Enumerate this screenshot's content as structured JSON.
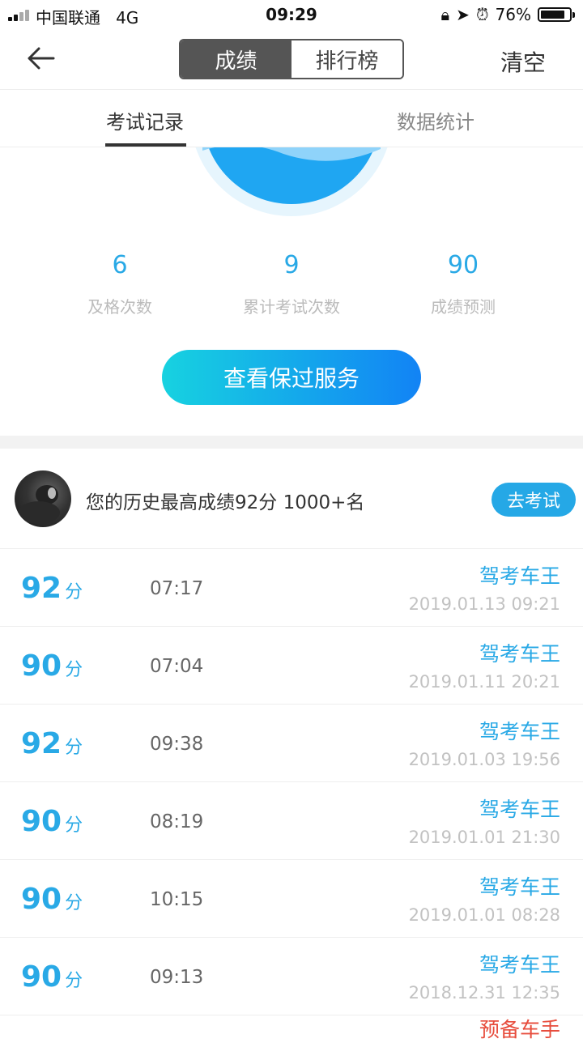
{
  "status": {
    "carrier": "中国联通",
    "network": "4G",
    "time": "09:29",
    "battery": "76%"
  },
  "nav": {
    "seg_scores": "成绩",
    "seg_ranking": "排行榜",
    "clear": "清空"
  },
  "tabs": {
    "records": "考试记录",
    "stats": "数据统计"
  },
  "stats": [
    {
      "value": "6",
      "label": "及格次数"
    },
    {
      "value": "9",
      "label": "累计考试次数"
    },
    {
      "value": "90",
      "label": "成绩预测"
    }
  ],
  "cta": "查看保过服务",
  "best": {
    "text": "您的历史最高成绩92分  1000+名",
    "button": "去考试"
  },
  "records": [
    {
      "score": "92",
      "unit": "分",
      "duration": "07:17",
      "source": "驾考车王",
      "date": "2019.01.13 09:21"
    },
    {
      "score": "90",
      "unit": "分",
      "duration": "07:04",
      "source": "驾考车王",
      "date": "2019.01.11 20:21"
    },
    {
      "score": "92",
      "unit": "分",
      "duration": "09:38",
      "source": "驾考车王",
      "date": "2019.01.03 19:56"
    },
    {
      "score": "90",
      "unit": "分",
      "duration": "08:19",
      "source": "驾考车王",
      "date": "2019.01.01 21:30"
    },
    {
      "score": "90",
      "unit": "分",
      "duration": "10:15",
      "source": "驾考车王",
      "date": "2019.01.01 08:28"
    },
    {
      "score": "90",
      "unit": "分",
      "duration": "09:13",
      "source": "驾考车王",
      "date": "2018.12.31 12:35"
    }
  ],
  "partial_source": "预备车手",
  "colors": {
    "accent": "#29a9e6",
    "cta_start": "#17d2e0",
    "cta_end": "#1283f5",
    "partial": "#e74c3c"
  }
}
